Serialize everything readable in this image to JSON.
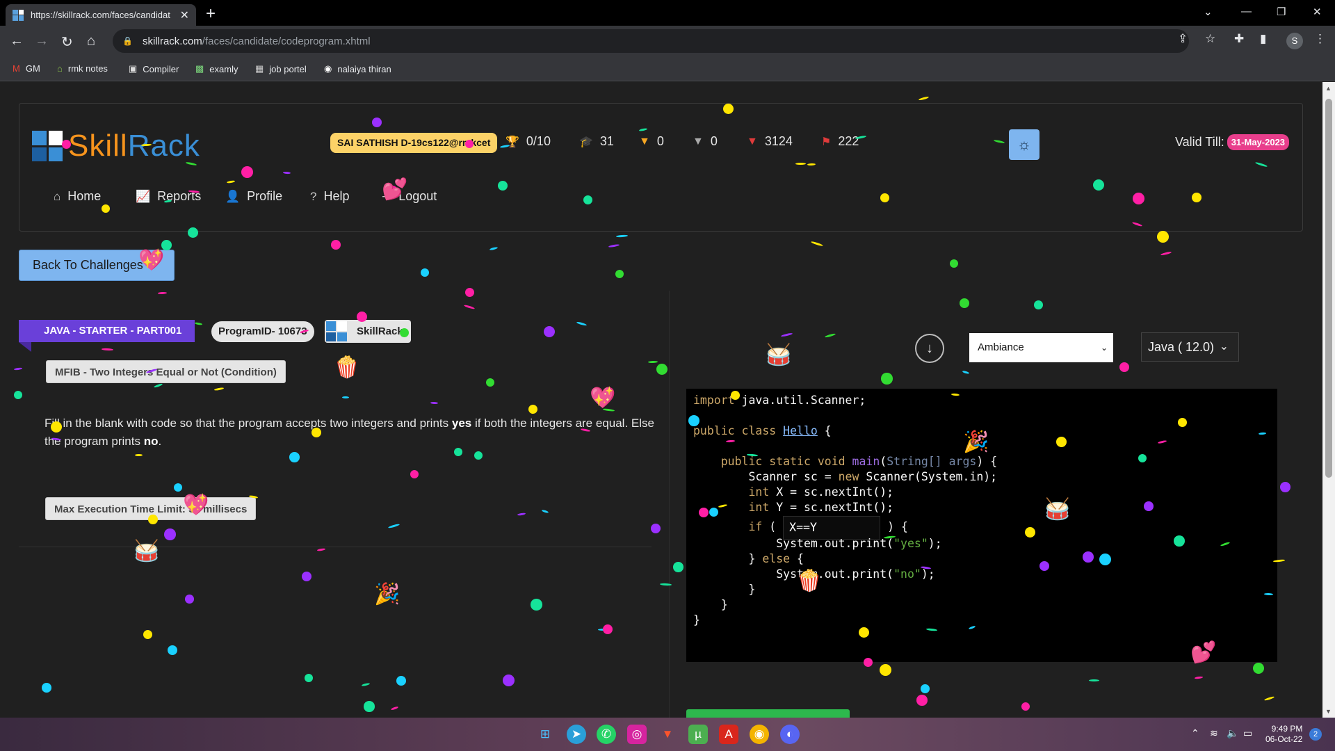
{
  "browser": {
    "tab_title": "https://skillrack.com/faces/candidat",
    "url_host": "skillrack.com",
    "url_path": "/faces/candidate/codeprogram.xhtml",
    "profile_initial": "S",
    "bookmarks": [
      "GM",
      "rmk notes",
      "Compiler",
      "examly",
      "job portel",
      "nalaiya thiran"
    ]
  },
  "header": {
    "logo_part1": "Skill",
    "logo_part2": "Rack",
    "user": "SAI SATHISH D-19cs122@rmkcet",
    "stats": {
      "trophies": "0/10",
      "courses": "31",
      "gold": "0",
      "silver": "0",
      "bronze": "3124",
      "flags": "222"
    },
    "valid_label": "Valid Till:",
    "valid_date": "31-May-2023",
    "menu": [
      "Home",
      "Reports",
      "Profile",
      "Help",
      "Logout"
    ]
  },
  "back_button": "Back To Challenges",
  "problem": {
    "track": "JAVA - STARTER - PART001",
    "program_id": "ProgramID- 10673",
    "company": "SkillRack",
    "title": "MFIB - Two Integers Equal or Not (Condition)",
    "desc_1": "Fill in the blank with code so that the program accepts two integers and prints ",
    "desc_yes": "yes",
    "desc_2": " if both the integers are equal. Else the program prints ",
    "desc_no": "no",
    "desc_end": ".",
    "time_limit": "Max Execution Time Limit: 50 millisecs"
  },
  "editor": {
    "theme": "Ambiance",
    "language": "Java ( 12.0)",
    "blank_value": "X==Y",
    "colors": {
      "keyword": "#cda869",
      "class": "#89bdff",
      "string": "#65b042"
    }
  },
  "taskbar": {
    "time": "9:49 PM",
    "date": "06-Oct-22",
    "notification_count": "2"
  }
}
